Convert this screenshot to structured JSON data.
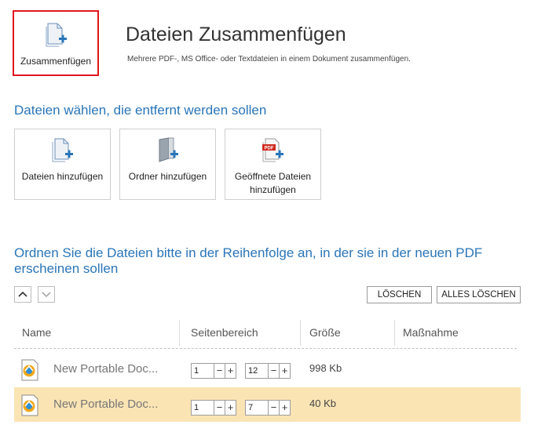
{
  "header": {
    "merge_button_label": "Zusammenfügen",
    "title": "Dateien Zusammenfügen",
    "subtitle": "Mehrere PDF-, MS Office- oder Textdateien in einem Dokument zusammenfügen."
  },
  "select_section": {
    "heading": "Dateien wählen, die entfernt werden sollen",
    "buttons": [
      {
        "label": "Dateien hinzufügen",
        "icon": "file-add-icon"
      },
      {
        "label": "Ordner hinzufügen",
        "icon": "folder-add-icon"
      },
      {
        "label": "Geöffnete Dateien hinzufügen",
        "icon": "pdf-add-icon"
      }
    ]
  },
  "order_section": {
    "heading": "Ordnen Sie die Dateien bitte in der Reihenfolge an, in der sie in der neuen PDF erscheinen sollen",
    "delete_label": "LÖSCHEN",
    "delete_all_label": "ALLES LÖSCHEN"
  },
  "table": {
    "columns": [
      "Name",
      "Seitenbereich",
      "Größe",
      "Maßnahme"
    ],
    "rows": [
      {
        "name": "New Portable Doc...",
        "from": "1",
        "to": "12",
        "size": "998 Kb",
        "selected": false
      },
      {
        "name": "New Portable Doc...",
        "from": "1",
        "to": "7",
        "size": "40 Kb",
        "selected": true
      }
    ]
  },
  "colors": {
    "accent": "#2a75b8",
    "highlight_border": "#e0141e",
    "selected_row": "#fbe4b4"
  }
}
